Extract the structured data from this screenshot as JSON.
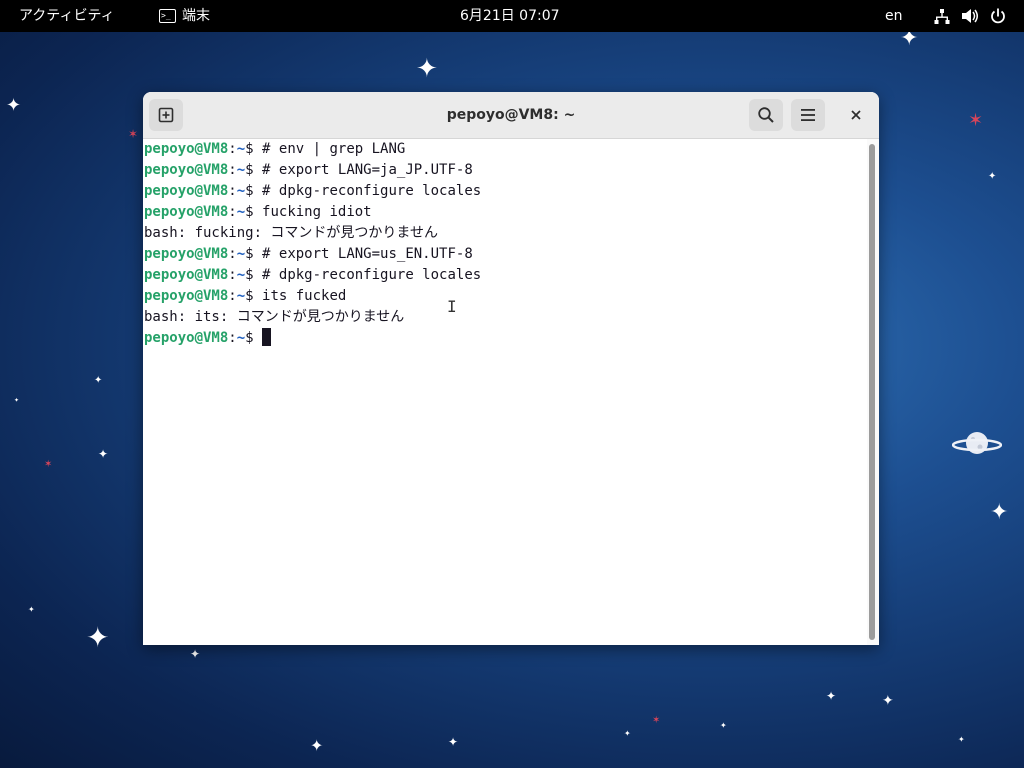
{
  "topbar": {
    "activities": "アクティビティ",
    "app_name": "端末",
    "app_icon_glyph": ">_",
    "clock": "6月21日 07:07",
    "language": "en",
    "icons": [
      "network-icon",
      "volume-icon",
      "power-icon"
    ]
  },
  "window": {
    "title": "pepoyo@VM8: ~",
    "buttons": {
      "new_tab": "new-tab-icon",
      "search": "search-icon",
      "menu": "hamburger-menu-icon",
      "close": "close-icon"
    }
  },
  "terminal": {
    "prompt_user": "pepoyo@VM8",
    "prompt_sep": ":",
    "prompt_path": "~",
    "prompt_symbol": "$ ",
    "lines": [
      {
        "type": "cmd",
        "text": "# env | grep LANG"
      },
      {
        "type": "cmd",
        "text": "# export LANG=ja_JP.UTF-8"
      },
      {
        "type": "cmd",
        "text": "# dpkg-reconfigure locales"
      },
      {
        "type": "cmd",
        "text": "fucking idiot"
      },
      {
        "type": "out",
        "text": "bash: fucking: コマンドが見つかりません"
      },
      {
        "type": "cmd",
        "text": "# export LANG=us_EN.UTF-8"
      },
      {
        "type": "cmd",
        "text": "# dpkg-reconfigure locales"
      },
      {
        "type": "cmd",
        "text": "its fucked"
      },
      {
        "type": "out",
        "text": "bash: its: コマンドが見つかりません"
      },
      {
        "type": "cmd",
        "text": ""
      }
    ]
  },
  "colors": {
    "prompt_user": "#26a269",
    "prompt_path": "#1f5fbf",
    "terminal_bg": "#ffffff",
    "headerbar_bg": "#ebebeb",
    "topbar_bg": "#000000"
  }
}
